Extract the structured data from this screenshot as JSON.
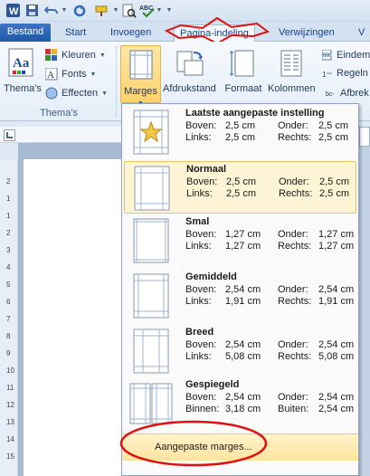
{
  "tabs": {
    "file": "Bestand",
    "start": "Start",
    "insert": "Invoegen",
    "page_layout": "Pagina-indeling",
    "references": "Verwijzingen",
    "more": "V"
  },
  "ribbon": {
    "themes": {
      "themes_label": "Thema's",
      "colors": "Kleuren",
      "fonts": "Fonts",
      "effects": "Effecten",
      "group_label": "Thema's"
    },
    "margins_label": "Marges",
    "orientation_label": "Afdrukstand",
    "size_label": "Formaat",
    "columns_label": "Kolommen",
    "breaks_label": "Eindem",
    "line_numbers_label": "Regeln",
    "hyphenation_label": "Afbrek"
  },
  "margins_menu": {
    "options": [
      {
        "name": "Laatste aangepaste instelling",
        "row1_label_a": "Boven:",
        "row1_value_a": "2,5 cm",
        "row1_label_b": "Onder:",
        "row1_value_b": "2,5 cm",
        "row2_label_a": "Links:",
        "row2_value_a": "2,5 cm",
        "row2_label_b": "Rechts:",
        "row2_value_b": "2,5 cm"
      },
      {
        "name": "Normaal",
        "row1_label_a": "Boven:",
        "row1_value_a": "2,5 cm",
        "row1_label_b": "Onder:",
        "row1_value_b": "2,5 cm",
        "row2_label_a": "Links:",
        "row2_value_a": "2,5 cm",
        "row2_label_b": "Rechts:",
        "row2_value_b": "2,5 cm"
      },
      {
        "name": "Smal",
        "row1_label_a": "Boven:",
        "row1_value_a": "1,27 cm",
        "row1_label_b": "Onder:",
        "row1_value_b": "1,27 cm",
        "row2_label_a": "Links:",
        "row2_value_a": "1,27 cm",
        "row2_label_b": "Rechts:",
        "row2_value_b": "1,27 cm"
      },
      {
        "name": "Gemiddeld",
        "row1_label_a": "Boven:",
        "row1_value_a": "2,54 cm",
        "row1_label_b": "Onder:",
        "row1_value_b": "2,54 cm",
        "row2_label_a": "Links:",
        "row2_value_a": "1,91 cm",
        "row2_label_b": "Rechts:",
        "row2_value_b": "1,91 cm"
      },
      {
        "name": "Breed",
        "row1_label_a": "Boven:",
        "row1_value_a": "2,54 cm",
        "row1_label_b": "Onder:",
        "row1_value_b": "2,54 cm",
        "row2_label_a": "Links:",
        "row2_value_a": "5,08 cm",
        "row2_label_b": "Rechts:",
        "row2_value_b": "5,08 cm"
      },
      {
        "name": "Gespiegeld",
        "row1_label_a": "Boven:",
        "row1_value_a": "2,54 cm",
        "row1_label_b": "Onder:",
        "row1_value_b": "2,54 cm",
        "row2_label_a": "Binnen:",
        "row2_value_a": "3,18 cm",
        "row2_label_b": "Buiten:",
        "row2_value_b": "2,54 cm"
      }
    ],
    "custom_margins_label": "Aangepaste marges..."
  },
  "ruler_ticks": [
    "2",
    "1",
    "1",
    "2",
    "3",
    "4",
    "5",
    "6",
    "7",
    "8",
    "9",
    "10",
    "11",
    "12",
    "13",
    "14",
    "15"
  ],
  "colors": {
    "highlight": "#fbd26b",
    "annotation_red": "#e01010",
    "file_tab": "#2a67b8"
  }
}
